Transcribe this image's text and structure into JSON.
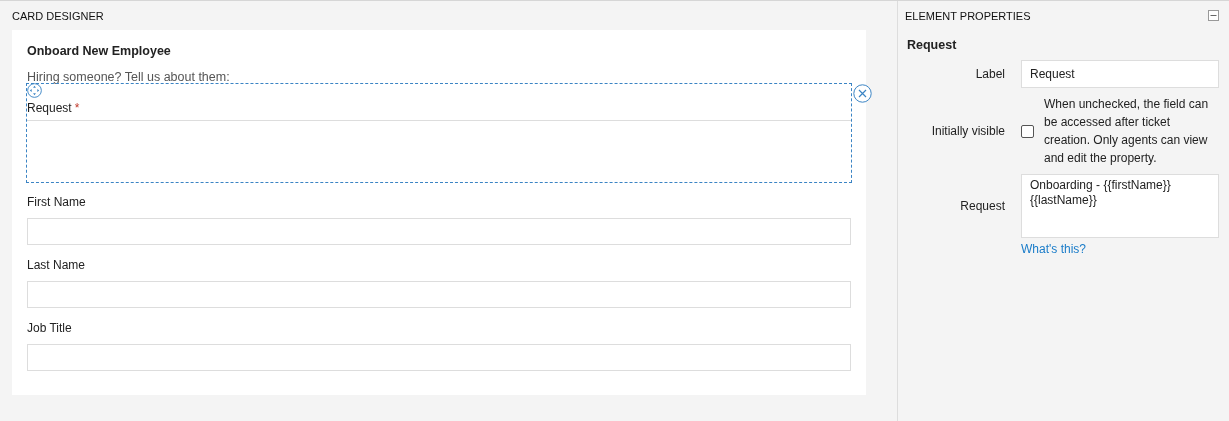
{
  "designer": {
    "title": "CARD DESIGNER",
    "card": {
      "title": "Onboard New Employee",
      "description": "Hiring someone? Tell us about them:",
      "fields": [
        {
          "kind": "textarea",
          "label": "Request",
          "required_mark": "*",
          "selected": true
        },
        {
          "kind": "text",
          "label": "First Name",
          "selected": false
        },
        {
          "kind": "text",
          "label": "Last Name",
          "selected": false
        },
        {
          "kind": "text",
          "label": "Job Title",
          "selected": false
        }
      ]
    }
  },
  "properties": {
    "title": "ELEMENT PROPERTIES",
    "element_title": "Request",
    "rows": [
      {
        "kind": "text",
        "label": "Label",
        "value": "Request"
      },
      {
        "kind": "checkbox",
        "label": "Initially visible",
        "checked": false,
        "description": "When unchecked, the field can be accessed after ticket creation. Only agents can view and edit the property."
      },
      {
        "kind": "textarea",
        "label": "Request",
        "value": "Onboarding - {{firstName}} {{lastName}}",
        "link": "What's this?"
      }
    ]
  }
}
